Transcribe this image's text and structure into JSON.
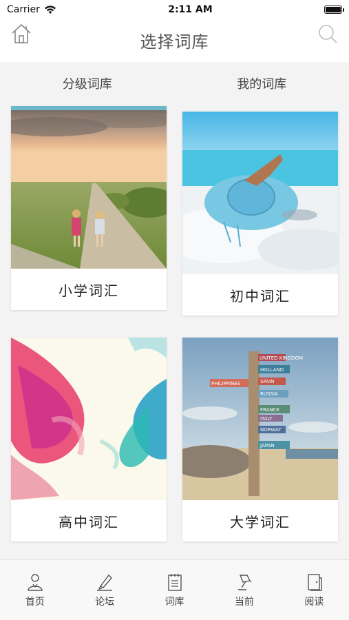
{
  "status_bar": {
    "carrier": "Carrier",
    "time": "2:11 AM"
  },
  "nav": {
    "title": "选择词库",
    "left_icon": "home-icon",
    "right_icon": "search-icon"
  },
  "segments": [
    {
      "label": "分级词库"
    },
    {
      "label": "我的词库"
    }
  ],
  "cards": [
    {
      "label": "小学词汇",
      "image": "girls-on-country-road-sunset"
    },
    {
      "label": "初中词汇",
      "image": "blue-sun-hat-on-beach"
    },
    {
      "label": "高中词汇",
      "image": "colorful-ink-smoke"
    },
    {
      "label": "大学词汇",
      "image": "wooden-direction-signpost"
    }
  ],
  "signpost_words": [
    "UNITED KINGDOM",
    "HOLLAND",
    "SPAIN",
    "PHILIPPINES",
    "RUSSIA",
    "FRANCE",
    "ITALY",
    "NORWAY",
    "JAPAN"
  ],
  "tab_bar": [
    {
      "label": "首页",
      "icon": "person-icon"
    },
    {
      "label": "论坛",
      "icon": "pen-icon"
    },
    {
      "label": "词库",
      "icon": "notebook-icon"
    },
    {
      "label": "当前",
      "icon": "lamp-icon"
    },
    {
      "label": "阅读",
      "icon": "book-icon"
    }
  ],
  "colors": {
    "background": "#f3f3f3",
    "tab_bar": "#f8f8f8",
    "text": "#333333"
  }
}
